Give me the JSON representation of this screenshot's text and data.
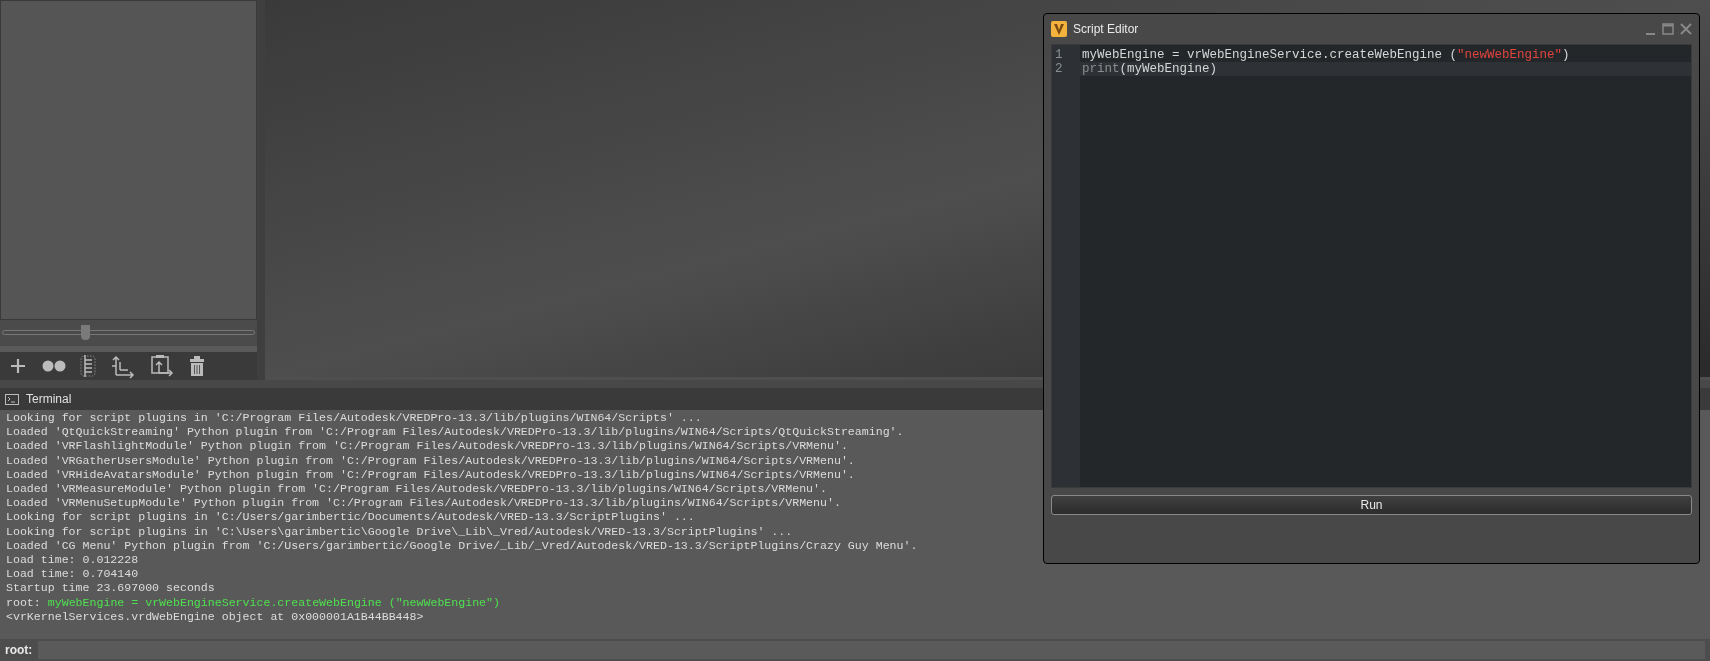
{
  "left_panel": {
    "slider": {
      "level": 0.33
    }
  },
  "terminal": {
    "title": "Terminal",
    "lines": [
      {
        "kind": "output",
        "text": "Looking for script plugins in 'C:/Program Files/Autodesk/VREDPro-13.3/lib/plugins/WIN64/Scripts' ..."
      },
      {
        "kind": "output",
        "text": "Loaded 'QtQuickStreaming' Python plugin from 'C:/Program Files/Autodesk/VREDPro-13.3/lib/plugins/WIN64/Scripts/QtQuickStreaming'."
      },
      {
        "kind": "output",
        "text": "Loaded 'VRFlashlightModule' Python plugin from 'C:/Program Files/Autodesk/VREDPro-13.3/lib/plugins/WIN64/Scripts/VRMenu'."
      },
      {
        "kind": "output",
        "text": "Loaded 'VRGatherUsersModule' Python plugin from 'C:/Program Files/Autodesk/VREDPro-13.3/lib/plugins/WIN64/Scripts/VRMenu'."
      },
      {
        "kind": "output",
        "text": "Loaded 'VRHideAvatarsModule' Python plugin from 'C:/Program Files/Autodesk/VREDPro-13.3/lib/plugins/WIN64/Scripts/VRMenu'."
      },
      {
        "kind": "output",
        "text": "Loaded 'VRMeasureModule' Python plugin from 'C:/Program Files/Autodesk/VREDPro-13.3/lib/plugins/WIN64/Scripts/VRMenu'."
      },
      {
        "kind": "output",
        "text": "Loaded 'VRMenuSetupModule' Python plugin from 'C:/Program Files/Autodesk/VREDPro-13.3/lib/plugins/WIN64/Scripts/VRMenu'."
      },
      {
        "kind": "output",
        "text": "Looking for script plugins in 'C:/Users/garimbertic/Documents/Autodesk/VRED-13.3/ScriptPlugins' ..."
      },
      {
        "kind": "output",
        "text": "Looking for script plugins in 'C:\\Users\\garimbertic\\Google Drive\\_Lib\\_Vred/Autodesk/VRED-13.3/ScriptPlugins' ..."
      },
      {
        "kind": "output",
        "text": "Loaded 'CG Menu' Python plugin from 'C:/Users/garimbertic/Google Drive/_Lib/_Vred/Autodesk/VRED-13.3/ScriptPlugins/Crazy Guy Menu'."
      },
      {
        "kind": "output",
        "text": "Load time: 0.012228"
      },
      {
        "kind": "output",
        "text": "Load time: 0.704140"
      },
      {
        "kind": "output",
        "text": "Startup time 23.697000 seconds"
      },
      {
        "kind": "command",
        "prompt": "root:",
        "text": "myWebEngine = vrWebEngineService.createWebEngine (\"newWebEngine\")"
      },
      {
        "kind": "output",
        "text": "<vrKernelServices.vrdWebEngine object at 0x000001A1B44BB448>"
      }
    ],
    "input": {
      "prompt": "root:"
    }
  },
  "script_editor": {
    "title": "Script Editor",
    "lines": [
      {
        "number": "1",
        "current": false,
        "tokens": [
          {
            "kind": "plain",
            "text": "myWebEngine = vrWebEngineService.createWebEngine ("
          },
          {
            "kind": "string",
            "text": "\"newWebEngine\""
          },
          {
            "kind": "plain",
            "text": ")"
          }
        ]
      },
      {
        "number": "2",
        "current": true,
        "tokens": [
          {
            "kind": "builtin",
            "text": "print"
          },
          {
            "kind": "plain",
            "text": "(myWebEngine)"
          }
        ]
      }
    ],
    "run_button": "Run"
  }
}
